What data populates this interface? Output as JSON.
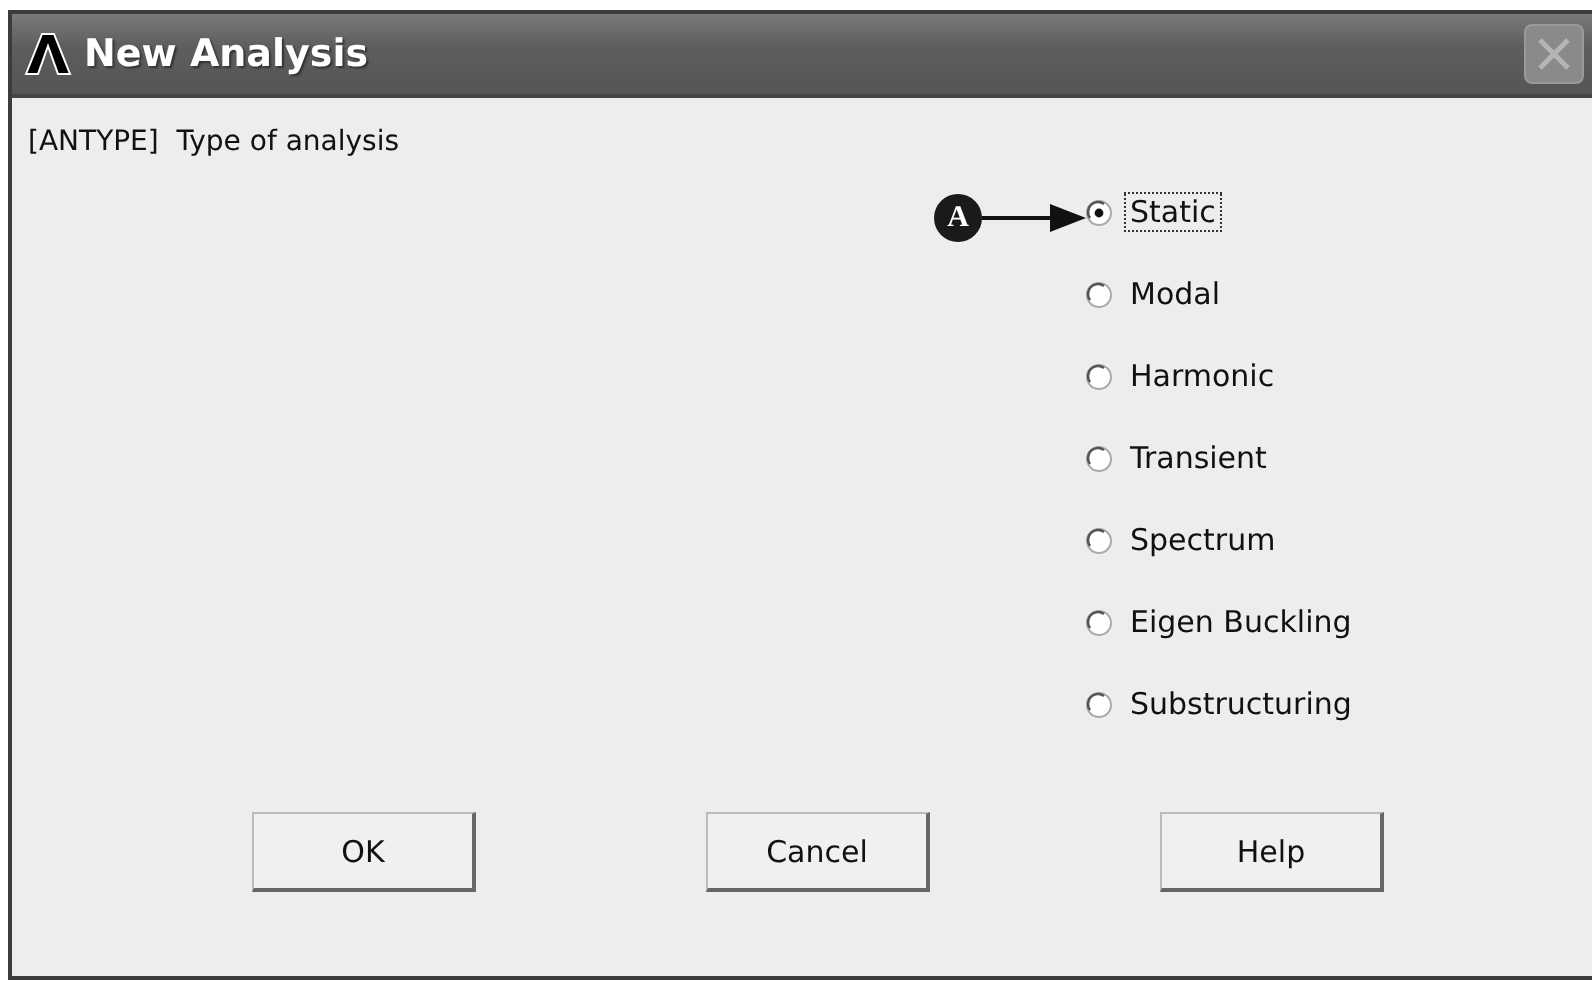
{
  "window": {
    "title": "New Analysis"
  },
  "prompt": "[ANTYPE]  Type of analysis",
  "options": [
    {
      "label": "Static",
      "selected": true,
      "focused": true
    },
    {
      "label": "Modal",
      "selected": false,
      "focused": false
    },
    {
      "label": "Harmonic",
      "selected": false,
      "focused": false
    },
    {
      "label": "Transient",
      "selected": false,
      "focused": false
    },
    {
      "label": "Spectrum",
      "selected": false,
      "focused": false
    },
    {
      "label": "Eigen Buckling",
      "selected": false,
      "focused": false
    },
    {
      "label": "Substructuring",
      "selected": false,
      "focused": false
    }
  ],
  "callout": {
    "label": "A"
  },
  "buttons": [
    "OK",
    "Cancel",
    "Help"
  ]
}
